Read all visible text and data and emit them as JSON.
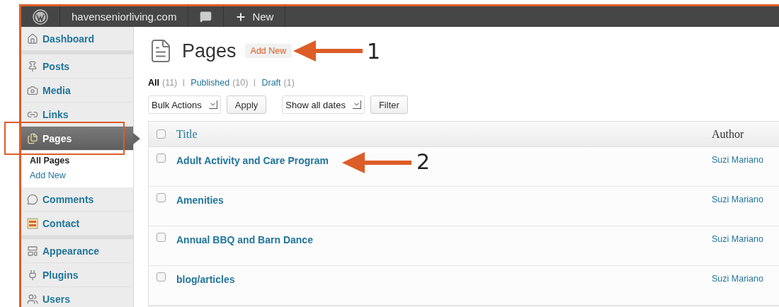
{
  "admin_bar": {
    "site_name": "havenseniorliving.com",
    "new_label": "New"
  },
  "sidebar": {
    "groups": [
      {
        "items": [
          {
            "label": "Dashboard",
            "selected": false
          }
        ]
      },
      {
        "items": [
          {
            "label": "Posts",
            "selected": false
          },
          {
            "label": "Media",
            "selected": false
          },
          {
            "label": "Links",
            "selected": false
          },
          {
            "label": "Pages",
            "selected": true,
            "children": [
              {
                "label": "All Pages",
                "selected": true
              },
              {
                "label": "Add New",
                "selected": false
              }
            ]
          },
          {
            "label": "Comments",
            "selected": false
          },
          {
            "label": "Contact",
            "selected": false
          }
        ]
      },
      {
        "items": [
          {
            "label": "Appearance",
            "selected": false
          },
          {
            "label": "Plugins",
            "selected": false
          },
          {
            "label": "Users",
            "selected": false
          }
        ]
      }
    ]
  },
  "page": {
    "title": "Pages",
    "add_new": "Add New",
    "views": [
      {
        "label": "All",
        "count": "(11)",
        "selected": true
      },
      {
        "label": "Published",
        "count": "(10)",
        "selected": false
      },
      {
        "label": "Draft",
        "count": "(1)",
        "selected": false
      }
    ],
    "bulk_actions": {
      "value": "Bulk Actions"
    },
    "apply": "Apply",
    "date_filter": {
      "value": "Show all dates"
    },
    "filter": "Filter"
  },
  "table": {
    "select_all_checked": false,
    "columns": [
      "Title",
      "Author"
    ],
    "rows": [
      {
        "title": "Adult Activity and Care Program",
        "author": "Suzi Mariano",
        "checked": false
      },
      {
        "title": "Amenities",
        "author": "Suzi Mariano",
        "checked": false
      },
      {
        "title": "Annual BBQ and Barn Dance",
        "author": "Suzi Mariano",
        "checked": false
      },
      {
        "title": "blog/articles",
        "author": "Suzi Mariano",
        "checked": false
      }
    ]
  },
  "annotations": [
    {
      "label": "1"
    },
    {
      "label": "2"
    }
  ]
}
